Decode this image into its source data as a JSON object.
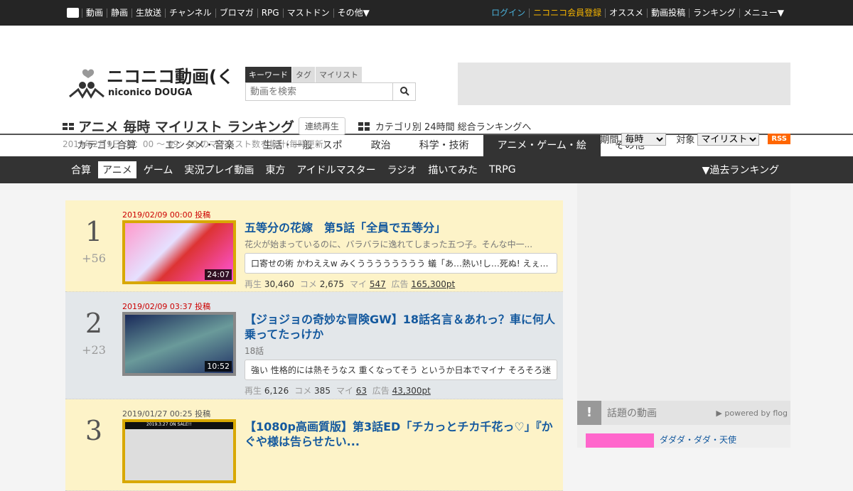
{
  "topbar": {
    "left": [
      "動画",
      "静画",
      "生放送",
      "チャンネル",
      "ブロマガ",
      "RPG",
      "マストドン",
      "その他▼"
    ],
    "login": "ログイン",
    "register": "ニコニコ会員登録",
    "right": [
      "オススメ",
      "動画投稿",
      "ランキング",
      "メニュー▼"
    ]
  },
  "logo": {
    "text": "ニコニコ動画(く)",
    "sub": "niconico DOUGA"
  },
  "search": {
    "tabs": [
      "キーワード",
      "タグ",
      "マイリスト"
    ],
    "placeholder": "動画を検索"
  },
  "page": {
    "title": "アニメ 毎時 マイリスト ランキング",
    "continuous": "連続再生",
    "cat_link": "カテゴリ別 24時間 総合ランキングへ",
    "date": "2019年2月9日",
    "range": " 08：00 ～ 09：00 のマイリスト数を集計(毎時更新)"
  },
  "filters": {
    "period_label": "期間",
    "period": "毎時",
    "target_label": "対象",
    "target": "マイリスト",
    "rss": "RSS"
  },
  "categories": [
    "カテゴリ合算",
    "エンタメ・音楽",
    "生活・一般・スポ",
    "政治",
    "科学・技術",
    "アニメ・ゲーム・絵",
    "その他"
  ],
  "subnav": {
    "items": [
      "合算",
      "アニメ",
      "ゲーム",
      "実況プレイ動画",
      "東方",
      "アイドルマスター",
      "ラジオ",
      "描いてみた",
      "TRPG"
    ],
    "past": "▼過去ランキング"
  },
  "items": [
    {
      "rank": "1",
      "delta": "+56",
      "posted": "2019/02/09 00:00 投稿",
      "duration": "24:07",
      "title": "五等分の花嫁　第5話「全員で五等分」",
      "desc": "花火が始まっているのに、バラバラに逸れてしまった五つ子。そんな中一...",
      "comment": "口寄せの術 かわええw みくうううううううう 蟻「あ…熱い!し…死ぬ! えぇ…",
      "views_label": "再生",
      "views": "30,460",
      "comments_label": "コメ",
      "comments": "2,675",
      "mylist_label": "マイ",
      "mylist": "547",
      "ad_label": "広告",
      "ad": "165,300pt"
    },
    {
      "rank": "2",
      "delta": "+23",
      "posted": "2019/02/09 03:37 投稿",
      "duration": "10:52",
      "title": "【ジョジョの奇妙な冒険GW】18話名言＆あれっ？車に何人乗ってたっけか",
      "desc": "18話",
      "comment": "強い 性格的には熱そうなス 重くなってそう というか日本でマイナ そろそろ迷",
      "views_label": "再生",
      "views": "6,126",
      "comments_label": "コメ",
      "comments": "385",
      "mylist_label": "マイ",
      "mylist": "63",
      "ad_label": "広告",
      "ad": "43,300pt"
    },
    {
      "rank": "3",
      "posted": "2019/01/27 00:25 投稿",
      "title": "【1080p高画質版】第3話ED「チカっとチカ千花っ♡」『かぐや様は告らせたい...",
      "thumb_text": "2019.3.27 ON SALE!!"
    }
  ],
  "topic": {
    "title": "話題の動画",
    "powered": "▶ powered by flog",
    "item": "ダダダ・ダダ・天使"
  }
}
